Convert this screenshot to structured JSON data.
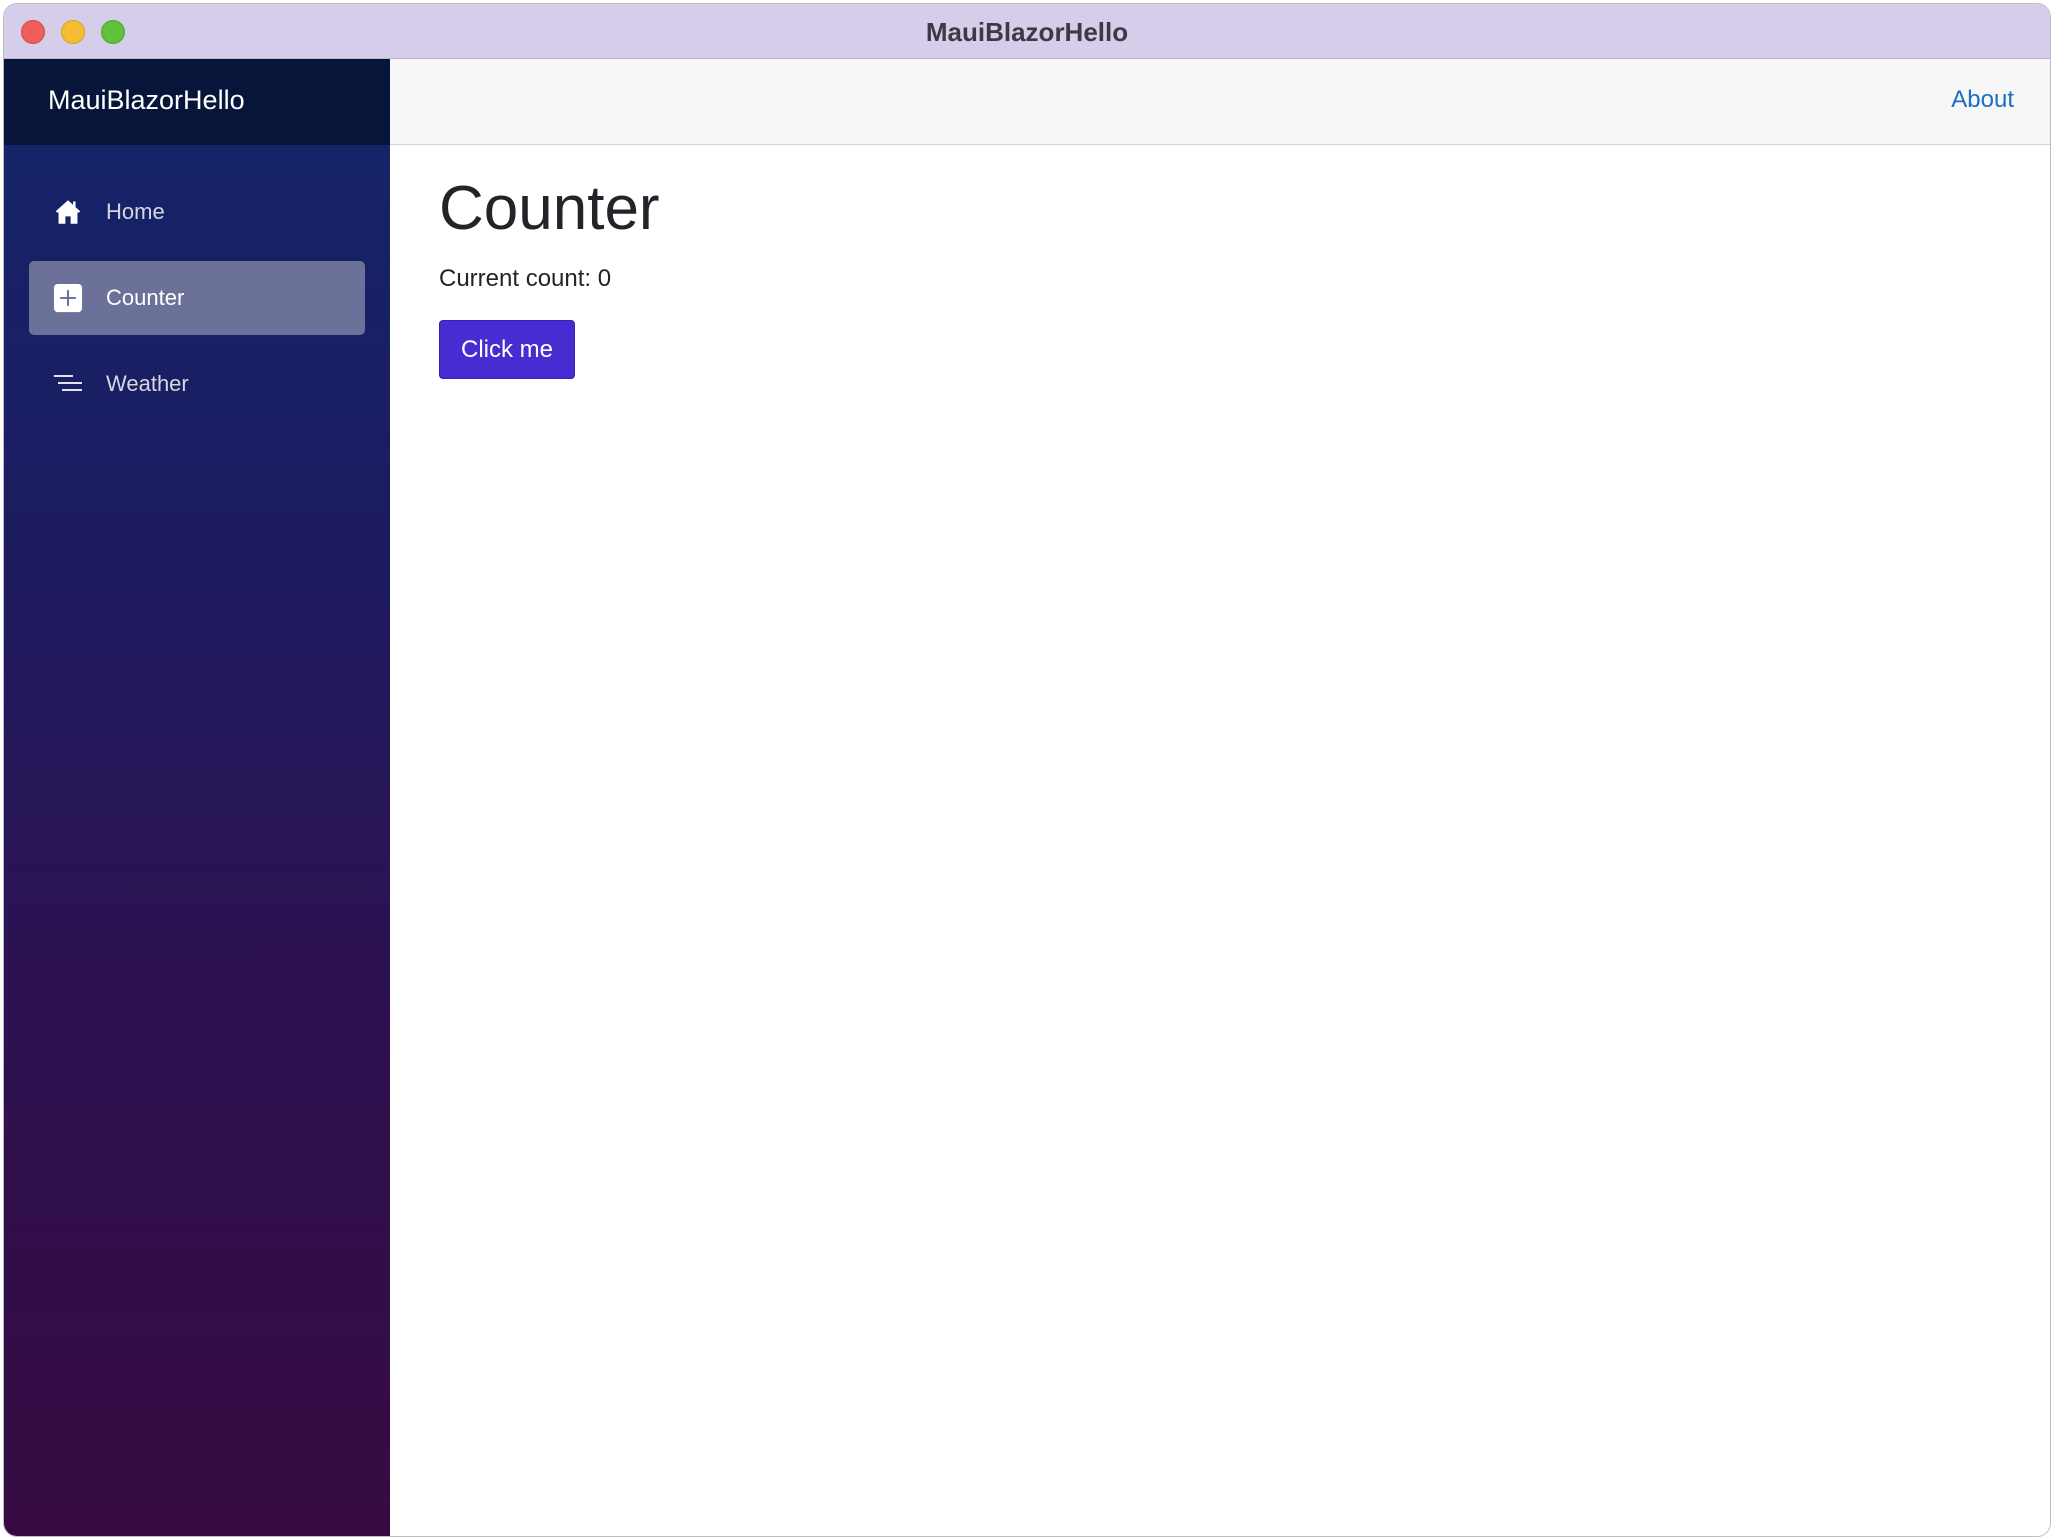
{
  "window": {
    "title": "MauiBlazorHello"
  },
  "sidebar": {
    "brand": "MauiBlazorHello",
    "items": [
      {
        "label": "Home",
        "icon": "house-icon",
        "active": false
      },
      {
        "label": "Counter",
        "icon": "plus-square-icon",
        "active": true
      },
      {
        "label": "Weather",
        "icon": "list-lines-icon",
        "active": false
      }
    ]
  },
  "header": {
    "about_label": "About"
  },
  "main": {
    "title": "Counter",
    "count_text": "Current count: 0",
    "button_label": "Click me"
  },
  "colors": {
    "accent_button": "#482bd1",
    "link": "#1b6ec2",
    "titlebar": "#d5cdea",
    "sidebar_top": "#13266a",
    "sidebar_bottom": "#360b41"
  }
}
